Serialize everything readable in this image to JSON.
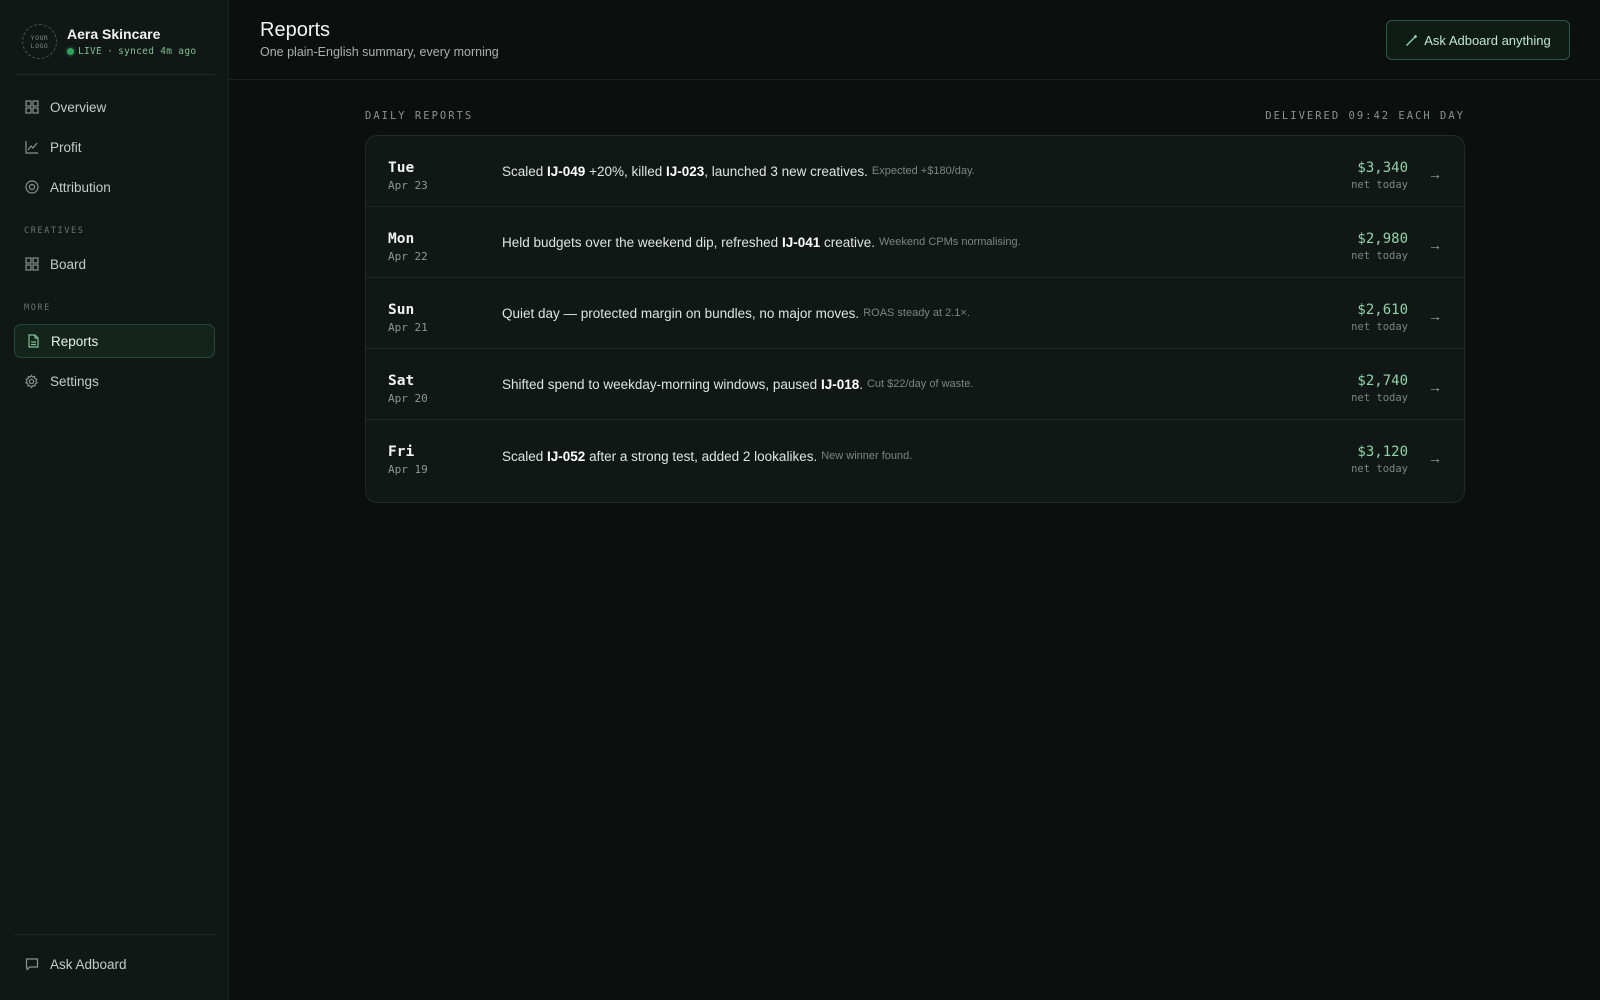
{
  "brand": {
    "logo_line1": "YOUR",
    "logo_line2": "LOGO",
    "name": "Aera Skincare",
    "live": "LIVE",
    "separator": "·",
    "synced": "synced 4m ago"
  },
  "sidebar": {
    "items_top": [
      {
        "label": "Overview",
        "icon": "grid-icon"
      },
      {
        "label": "Profit",
        "icon": "chart-line-icon"
      },
      {
        "label": "Attribution",
        "icon": "target-icon"
      }
    ],
    "section_creatives": "CREATIVES",
    "board": {
      "label": "Board",
      "icon": "grid-icon"
    },
    "section_more": "MORE",
    "reports": {
      "label": "Reports",
      "icon": "document-icon"
    },
    "settings": {
      "label": "Settings",
      "icon": "gear-icon"
    },
    "ask": {
      "label": "Ask Adboard",
      "icon": "chat-bubble-icon"
    }
  },
  "header": {
    "title": "Reports",
    "subtitle": "One plain-English summary, every morning",
    "ask_button": "Ask Adboard anything"
  },
  "list": {
    "heading": "DAILY REPORTS",
    "delivery": "DELIVERED 09:42 EACH DAY",
    "rows": [
      {
        "day": "Tue",
        "date": "Apr 23",
        "s1": "Scaled ",
        "b1": "IJ-049",
        "s2": " +20%, killed ",
        "b2": "IJ-023",
        "s3": ", launched 3 new creatives.",
        "note": "Expected +$180/day.",
        "amount": "$3,340",
        "amount_label": "net today"
      },
      {
        "day": "Mon",
        "date": "Apr 22",
        "s1": "Held budgets over the weekend dip, refreshed ",
        "b1": "IJ-041",
        "s2": " creative.",
        "b2": "",
        "s3": "",
        "note": "Weekend CPMs normalising.",
        "amount": "$2,980",
        "amount_label": "net today"
      },
      {
        "day": "Sun",
        "date": "Apr 21",
        "s1": "Quiet day — protected margin on bundles, no major moves.",
        "b1": "",
        "s2": "",
        "b2": "",
        "s3": "",
        "note": "ROAS steady at 2.1×.",
        "amount": "$2,610",
        "amount_label": "net today"
      },
      {
        "day": "Sat",
        "date": "Apr 20",
        "s1": "Shifted spend to weekday-morning windows, paused ",
        "b1": "IJ-018",
        "s2": ".",
        "b2": "",
        "s3": "",
        "note": "Cut $22/day of waste.",
        "amount": "$2,740",
        "amount_label": "net today"
      },
      {
        "day": "Fri",
        "date": "Apr 19",
        "s1": "Scaled ",
        "b1": "IJ-052",
        "s2": " after a strong test, added 2 lookalikes.",
        "b2": "",
        "s3": "",
        "note": "New winner found.",
        "amount": "$3,120",
        "amount_label": "net today"
      }
    ],
    "arrow": "→"
  },
  "colors": {
    "background": "#0b0f0e",
    "sidebar": "#111715",
    "accent_green": "#8fd3a8",
    "live_dot": "#2fa35a",
    "active_border": "#244a35"
  }
}
